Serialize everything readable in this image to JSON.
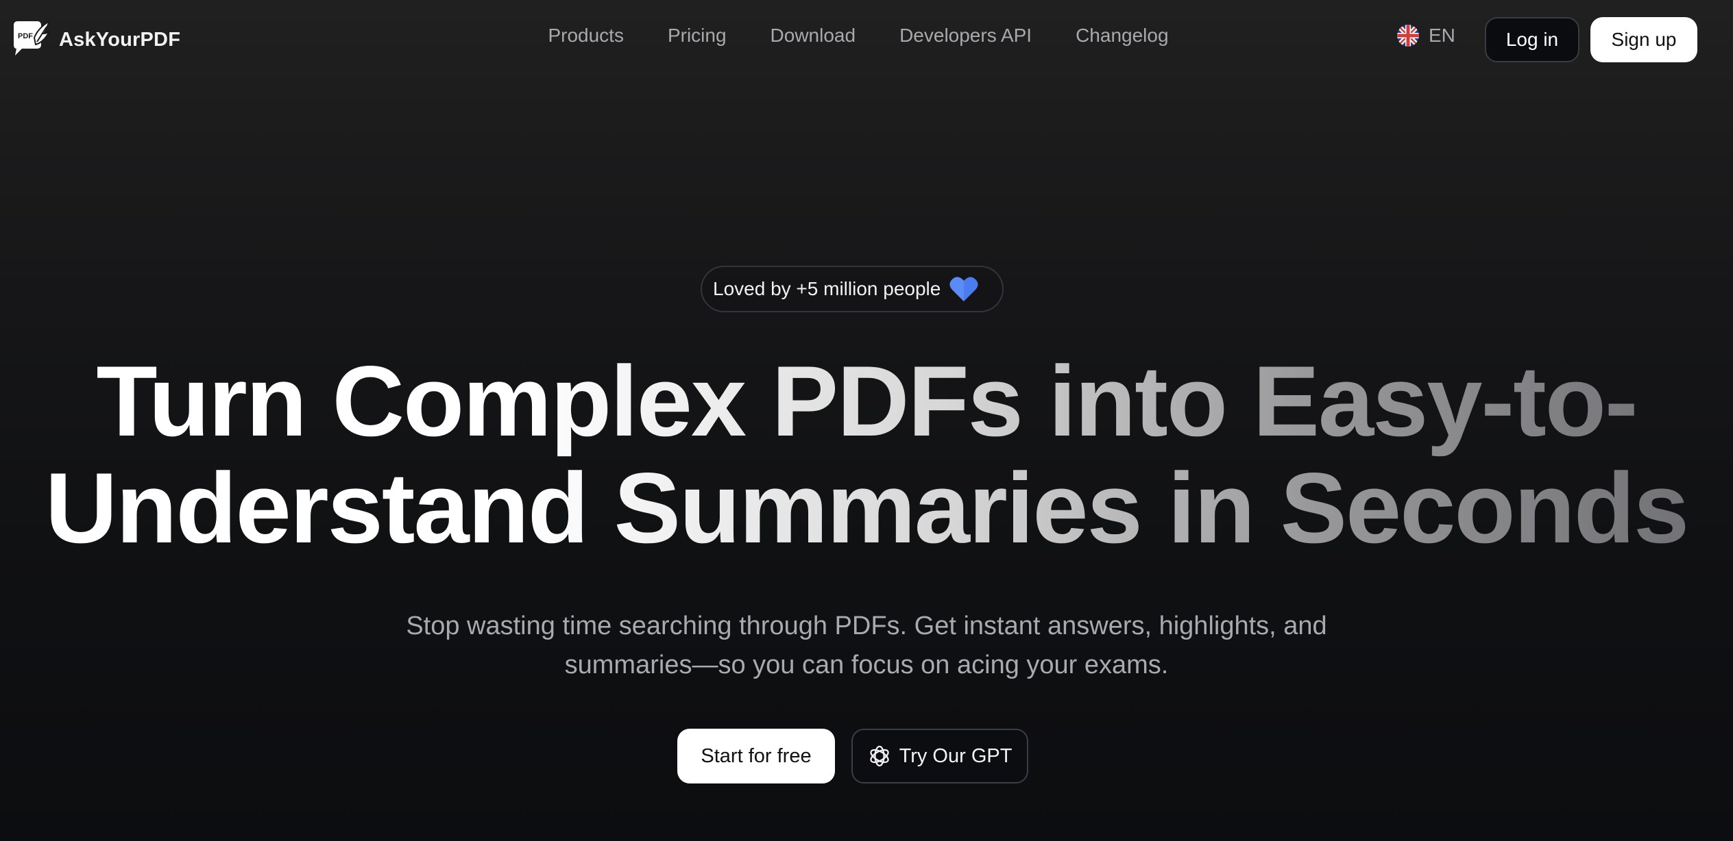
{
  "header": {
    "brand": {
      "name": "AskYourPDF",
      "logo_text": "PDF",
      "logo_icon": "pdf-chat-bubble-logo"
    },
    "nav": {
      "items": [
        {
          "label": "Products"
        },
        {
          "label": "Pricing"
        },
        {
          "label": "Download"
        },
        {
          "label": "Developers API"
        },
        {
          "label": "Changelog"
        }
      ]
    },
    "language": {
      "code": "EN",
      "flag_icon": "uk-flag-icon"
    },
    "login_label": "Log in",
    "signup_label": "Sign up"
  },
  "hero": {
    "badge": {
      "text": "Loved by +5 million people",
      "icon": "blue-heart-icon",
      "icon_color": "#4a7cf0"
    },
    "headline": {
      "line1": "Turn Complex PDFs into Easy-to-",
      "line2": "Understand Summaries in Seconds"
    },
    "subtitle": {
      "line1": "Stop wasting time searching through PDFs. Get instant answers, highlights, and",
      "line2": "summaries—so you can focus on acing your exams."
    },
    "cta_primary": "Start for free",
    "cta_secondary": {
      "label": "Try Our GPT",
      "icon": "openai-icon"
    }
  },
  "colors": {
    "background": "#0f1012",
    "nav_text": "#a9a9ae",
    "subtitle_text": "#a9aab0",
    "primary_button_bg": "#ffffff",
    "heart": "#4a7cf0"
  }
}
